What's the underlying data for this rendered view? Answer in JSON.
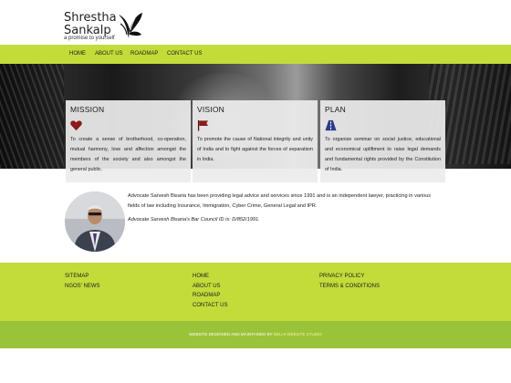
{
  "brand": {
    "line1": "Shrestha",
    "line2": "Sankalp",
    "tagline": "a promise to yourself",
    "logo_icon": "butterfly-icon"
  },
  "nav": {
    "items": [
      {
        "label": "HOME"
      },
      {
        "label": "ABOUT US"
      },
      {
        "label": "ROADMAP"
      },
      {
        "label": "CONTACT US"
      }
    ]
  },
  "cards": [
    {
      "title": "MISSION",
      "icon": "heart-icon",
      "icon_color": "#8b1a1a",
      "text": "To create a sense of brotherhood, co-operation, mutual harmony, love and affection amongst the members of the society and also amongst the general public."
    },
    {
      "title": "VISION",
      "icon": "flag-icon",
      "icon_color": "#8b1a1a",
      "text": "To promote the cause of National integrity and unity of India and to fight against the forces of separatism in India."
    },
    {
      "title": "PLAN",
      "icon": "road-icon",
      "icon_color": "#2b3a8c",
      "text": "To organize seminar on social justice, educational and economical upliftment to raise legal demands and fundamental rights provided by the Constitution of India."
    }
  ],
  "about": {
    "text": "Advocate Sarvesh Bisaria has been providing legal advice and services since 1991 and is an independent lawyer, practicing in various fields of law including Insurance, Immigration, Cyber Crime, General Legal and IPR.",
    "bar_id": "Advocate Sarvesh Bisaria's Bar Council ID is: D/852/1991."
  },
  "footer": {
    "col1": [
      "SITEMAP",
      "NGOS' NEWS"
    ],
    "col2": [
      "HOME",
      "ABOUT US",
      "ROADMAP",
      "CONTACT US"
    ],
    "col3": [
      "PRIVACY POLICY",
      "TERMS & CONDITIONS"
    ]
  },
  "credit": {
    "prefix": "WEBSITE DESIGNED AND MAINTAINED BY",
    "link": "DELHI WEBSITE STUDIO"
  },
  "colors": {
    "accent_green": "#c3dc3a",
    "footer_bottom": "#9ac339"
  }
}
